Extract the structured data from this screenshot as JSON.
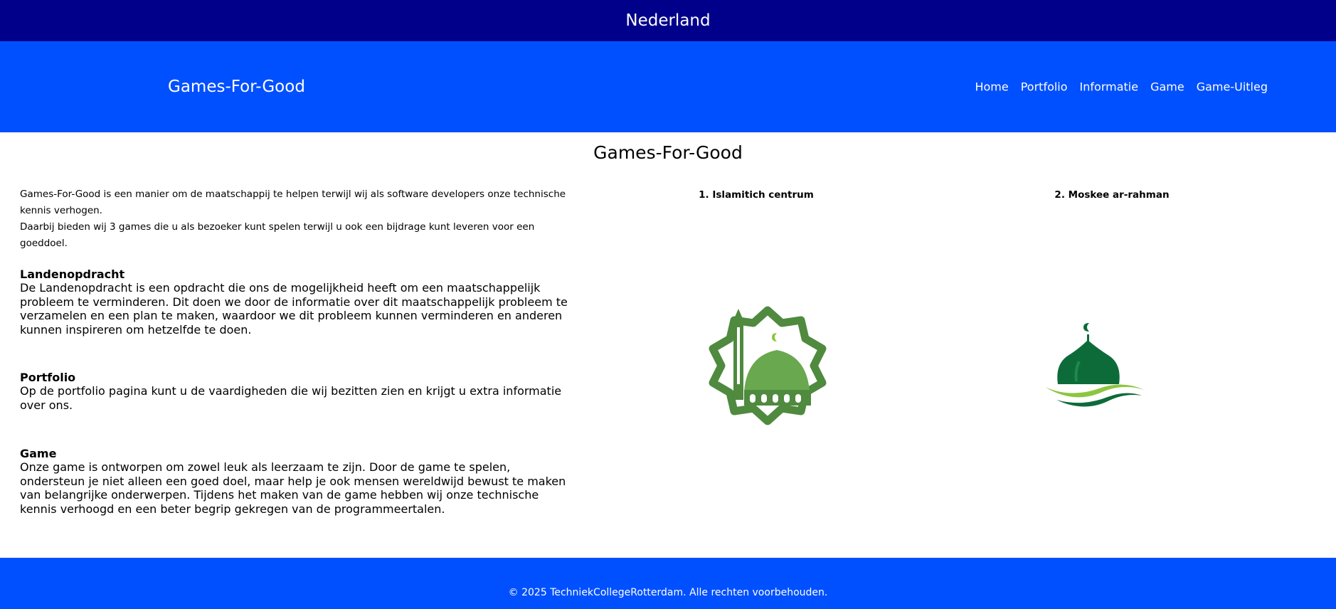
{
  "topbar": {
    "title": "Nederland"
  },
  "navbar": {
    "brand": "Games-For-Good",
    "links": [
      "Home",
      "Portfolio",
      "Informatie",
      "Game",
      "Game-Uitleg"
    ]
  },
  "main": {
    "title": "Games-For-Good",
    "intro_line1": "Games-For-Good is een manier om de maatschappij te helpen terwijl wij als software developers onze technische kennis verhogen.",
    "intro_line2": "Daarbij bieden wij 3 games die u als bezoeker kunt spelen terwijl u ook een bijdrage kunt leveren voor een goeddoel.",
    "sections": [
      {
        "heading": "Landenopdracht",
        "text": "De Landenopdracht is een opdracht die ons de mogelijkheid heeft om een maatschappelijk probleem te verminderen. Dit doen we door de informatie over dit maatschappelijk probleem te verzamelen en een plan te maken, waardoor we dit probleem kunnen verminderen en anderen kunnen inspireren om hetzelfde te doen."
      },
      {
        "heading": "Portfolio",
        "text": "Op de portfolio pagina kunt u de vaardigheden die wij bezitten zien en krijgt u extra informatie over ons."
      },
      {
        "heading": "Game",
        "text": "Onze game is ontworpen om zowel leuk als leerzaam te zijn. Door de game te spelen, ondersteun je niet alleen een goed doel, maar help je ook mensen wereldwijd bewust te maken van belangrijke onderwerpen. Tijdens het maken van de game hebben wij onze technische kennis verhoogd en een beter begrip gekregen van de programmeertalen."
      }
    ],
    "cards": [
      {
        "title": "1. Islamitich centrum",
        "icon": "mosque-logo-icon"
      },
      {
        "title": "2. Moskee ar-rahman",
        "icon": "dome-logo-icon"
      }
    ]
  },
  "footer": {
    "text": "© 2025 TechniekCollegeRotterdam. Alle rechten voorbehouden."
  },
  "colors": {
    "topbar": "#00008b",
    "navbar": "#0050ff",
    "logo_green": "#4f8a3f",
    "logo_dark_green": "#0d6b3a",
    "logo_light_green": "#8cc63f"
  }
}
